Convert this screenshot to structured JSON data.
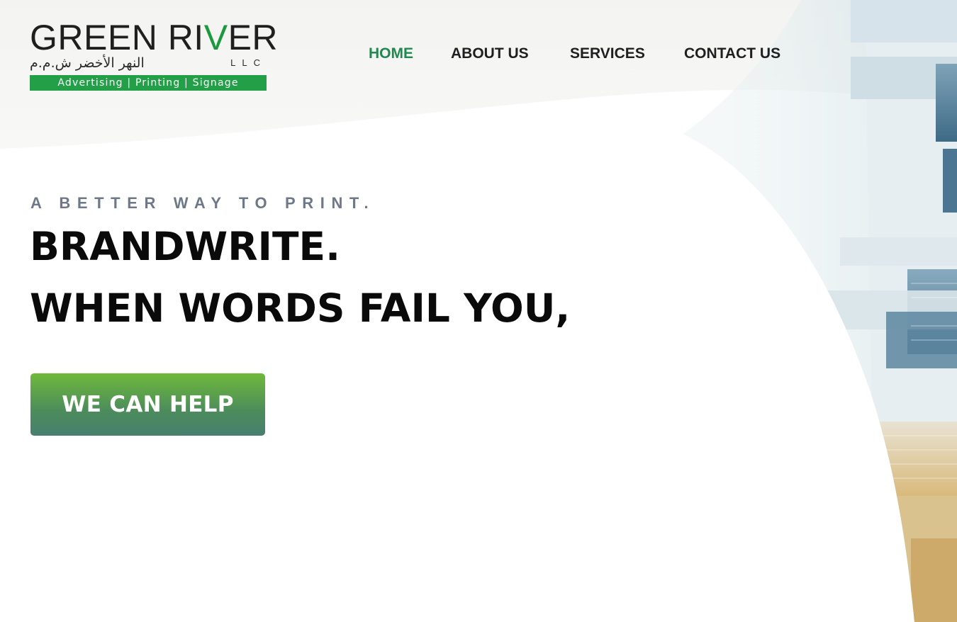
{
  "logo": {
    "name_part1": "GREEN RI",
    "name_v": "V",
    "name_part2": "ER",
    "arabic": "النهر الأخضر ش.م.م",
    "llc": "LLC",
    "tagline_bar": "Advertising  |  Printing  |  Signage"
  },
  "nav": {
    "items": [
      {
        "label": "HOME",
        "active": true
      },
      {
        "label": "ABOUT US",
        "active": false
      },
      {
        "label": "SERVICES",
        "active": false
      },
      {
        "label": "CONTACT US",
        "active": false
      }
    ]
  },
  "hero": {
    "eyebrow": "A BETTER WAY TO PRINT.",
    "headline_line1": "BRANDWRITE.",
    "headline_line2": "WHEN WORDS FAIL YOU,",
    "cta_label": "WE CAN HELP"
  },
  "colors": {
    "brand_green": "#23a047",
    "nav_active": "#1e8a4e",
    "text_dark": "#0a0a0a",
    "eyebrow_gray": "#6e7888"
  }
}
